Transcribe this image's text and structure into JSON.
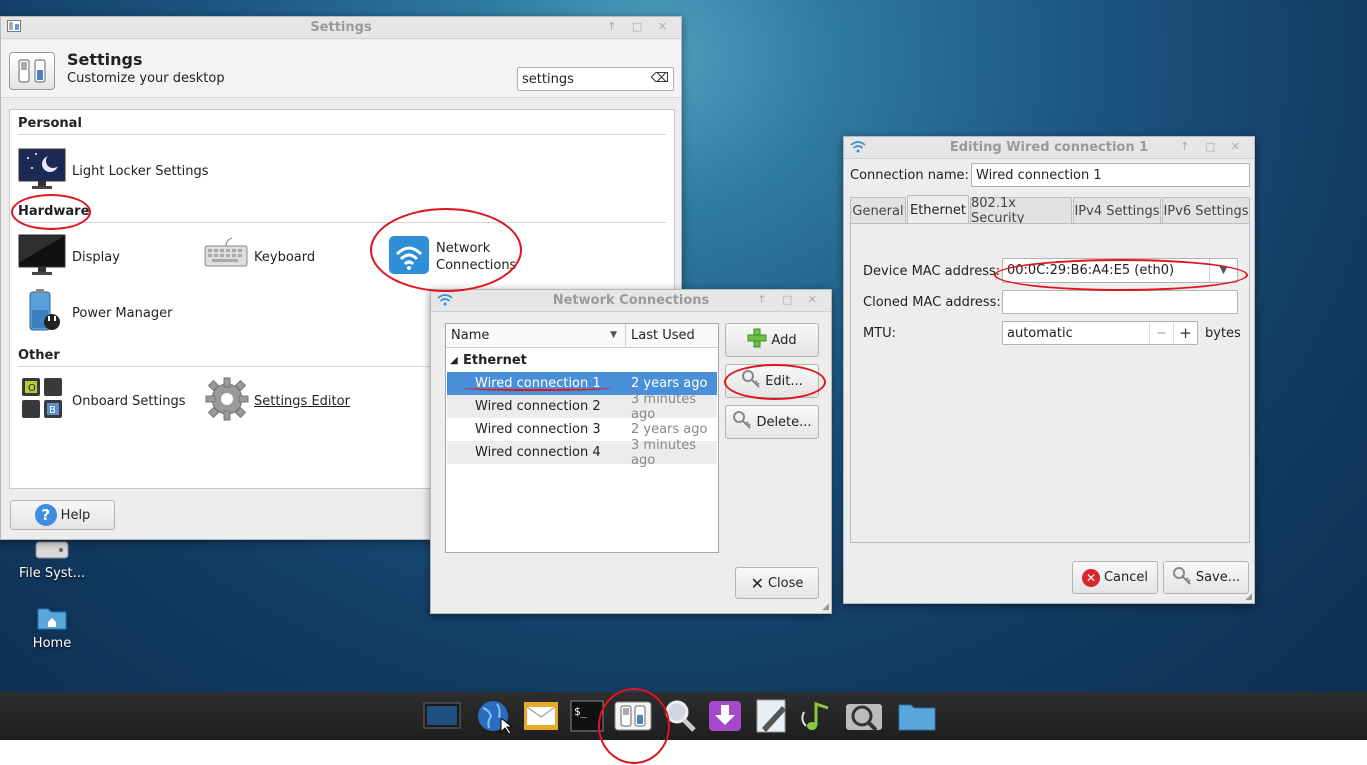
{
  "desktop": {
    "icons": [
      {
        "label": "File Syst..."
      },
      {
        "label": "Home"
      }
    ]
  },
  "settings_window": {
    "title": "Settings",
    "header_title": "Settings",
    "header_subtitle": "Customize your desktop",
    "search_value": "settings",
    "sections": {
      "personal": "Personal",
      "hardware": "Hardware",
      "other": "Other"
    },
    "items": {
      "light_locker": "Light Locker Settings",
      "display": "Display",
      "keyboard": "Keyboard",
      "network_line1": "Network",
      "network_line2": "Connections",
      "power": "Power Manager",
      "onboard": "Onboard Settings",
      "settings_editor": "Settings Editor"
    },
    "help_label": "Help"
  },
  "network_window": {
    "title": "Network Connections",
    "columns": {
      "name": "Name",
      "last_used": "Last Used"
    },
    "group": "Ethernet",
    "connections": [
      {
        "name": "Wired connection 1",
        "last_used": "2 years ago"
      },
      {
        "name": "Wired connection 2",
        "last_used": "3 minutes ago"
      },
      {
        "name": "Wired connection 3",
        "last_used": "2 years ago"
      },
      {
        "name": "Wired connection 4",
        "last_used": "3 minutes ago"
      }
    ],
    "buttons": {
      "add": "Add",
      "edit": "Edit...",
      "delete": "Delete...",
      "close": "Close"
    }
  },
  "edit_window": {
    "title": "Editing Wired connection 1",
    "connection_name_label": "Connection name:",
    "connection_name_value": "Wired connection 1",
    "tabs": [
      "General",
      "Ethernet",
      "802.1x Security",
      "IPv4 Settings",
      "IPv6 Settings"
    ],
    "device_mac_label": "Device MAC address:",
    "device_mac_value": "00:0C:29:B6:A4:E5 (eth0)",
    "cloned_mac_label": "Cloned MAC address:",
    "cloned_mac_value": "",
    "mtu_label": "MTU:",
    "mtu_value": "automatic",
    "mtu_unit": "bytes",
    "buttons": {
      "cancel": "Cancel",
      "save": "Save..."
    }
  },
  "taskbar": {
    "items": [
      "desktop-icon",
      "browser-icon",
      "mail-icon",
      "terminal-icon",
      "settings-icon",
      "search-icon",
      "download-icon",
      "editor-icon",
      "music-icon",
      "viewer-icon",
      "files-icon"
    ]
  },
  "colors": {
    "accent": "#4a90d9",
    "annotation": "#e0141e"
  }
}
